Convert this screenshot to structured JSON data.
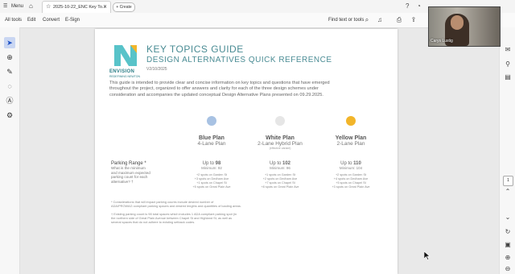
{
  "tabbar": {
    "menu_label": "Menu",
    "doc_tab_label": "2025-10-22_ENC Key To...",
    "create_label": "Create"
  },
  "toolbar": {
    "all_tools": "All tools",
    "edit": "Edit",
    "convert": "Convert",
    "esign": "E-Sign",
    "find": "Find text or tools"
  },
  "video": {
    "participant_name": "Carys Lustig"
  },
  "right_rail": {
    "page_number": "1"
  },
  "document": {
    "logo_text": "ENVISION",
    "logo_subtext": "REDEFINING NEWTON",
    "title": "KEY TOPICS GUIDE",
    "subtitle": "DESIGN ALTERNATIVES QUICK REFERENCE",
    "date": "V2/10/2025",
    "intro": [
      "This guide is intended to provide clear and concise information on key topics and questions that have emerged",
      "throughout the project, organized to offer answers and clarity for each of the three design schemes under",
      "consideration and accompanies the updated conceptual Design Alternative Plans presented on 09.29.2025."
    ],
    "plans": [
      {
        "name": "Blue Plan",
        "lanes": "4-Lane Plan",
        "note": "",
        "color": "#a8c2e3",
        "up_to": "98",
        "minimum": "Minimum: 92",
        "breakdown": [
          "+2 spots on Garden St",
          "+3 spots on Dedham Ave",
          "+1 spots on Chapel St",
          "+5 spots on Great Plain Ave"
        ]
      },
      {
        "name": "White Plan",
        "lanes": "2-Lane Hybrid Plan",
        "note": "(effective variant)",
        "color": "#e6e6e6",
        "up_to": "102",
        "minimum": "Minimum: 96",
        "breakdown": [
          "+1 spots on Garden St",
          "+2 spots on Dedham Ave",
          "+7 spots on Chapel St",
          "+8 spots on Great Plain Ave"
        ]
      },
      {
        "name": "Yellow Plan",
        "lanes": "2-Lane Plan",
        "note": "",
        "color": "#f2b52a",
        "up_to": "110",
        "minimum": "Minimum: 104",
        "breakdown": [
          "+2 spots on Garden St",
          "+4 spots on Dedham Ave",
          "+5 spots on Chapel St",
          "+3 spots on Great Plain Ave"
        ]
      }
    ],
    "parking": {
      "label": "Parking Range",
      "marker": "*",
      "question": [
        "What is the minimum",
        "and maximum expected",
        "parking count for each",
        "alternative? †"
      ],
      "up_to_prefix": "Up to"
    },
    "footnotes": [
      "* Considerations that will impact parking counts include desired number of",
      "ADA/PROWAG compliant parking spaces and desired lengths and quantities of loading areas.",
      "",
      "† Existing parking count is 98 total spaces which includes 1 ADA compliant parking spot (in",
      "the northern side of Great Plain Avenue between Chapel St and Highland St, as well as",
      "several spaces that do not adhere to existing setback codes."
    ]
  }
}
